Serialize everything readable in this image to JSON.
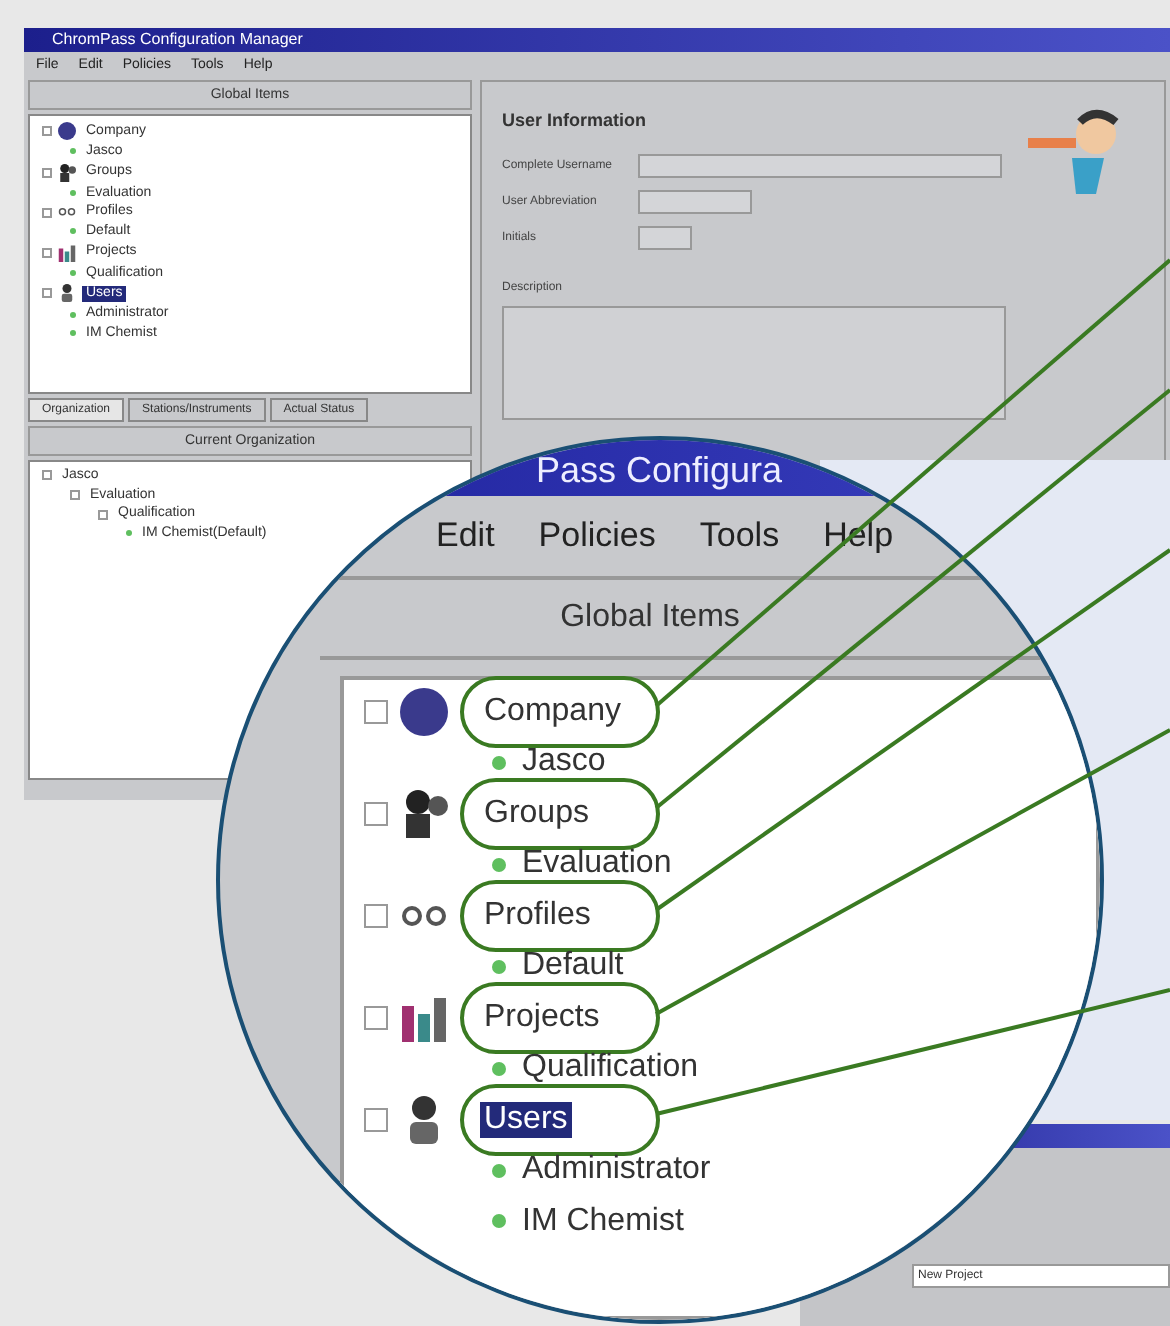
{
  "window": {
    "title": "ChromPass Configuration Manager",
    "menu": [
      "File",
      "Edit",
      "Policies",
      "Tools",
      "Help"
    ]
  },
  "global_items": {
    "title": "Global Items",
    "tree": [
      {
        "label": "Company",
        "kind": "company",
        "selected": false,
        "children": [
          {
            "label": "Jasco"
          }
        ]
      },
      {
        "label": "Groups",
        "kind": "groups",
        "selected": false,
        "children": [
          {
            "label": "Evaluation"
          }
        ]
      },
      {
        "label": "Profiles",
        "kind": "profiles",
        "selected": false,
        "children": [
          {
            "label": "Default"
          }
        ]
      },
      {
        "label": "Projects",
        "kind": "projects",
        "selected": false,
        "children": [
          {
            "label": "Qualification"
          }
        ]
      },
      {
        "label": "Users",
        "kind": "users",
        "selected": true,
        "children": [
          {
            "label": "Administrator"
          },
          {
            "label": "IM Chemist"
          }
        ]
      }
    ],
    "tabs": [
      {
        "label": "Organization",
        "selected": true
      },
      {
        "label": "Stations/Instruments",
        "selected": false
      },
      {
        "label": "Actual Status",
        "selected": false
      }
    ]
  },
  "current_organization": {
    "title": "Current Organization",
    "tree": [
      {
        "label": "Jasco",
        "children": [
          {
            "label": "Evaluation",
            "children": [
              {
                "label": "Qualification",
                "children": [
                  {
                    "label": "IM Chemist(Default)"
                  }
                ]
              }
            ]
          }
        ]
      }
    ]
  },
  "user_information": {
    "title": "User Information",
    "fields": [
      {
        "label": "Complete Username"
      },
      {
        "label": "User Abbreviation"
      },
      {
        "label": "Initials"
      }
    ],
    "description_label": "Description"
  },
  "second_window": {
    "field_value": "New Project"
  },
  "magnifier": {
    "title": "Pass Configura",
    "menu": [
      "Edit",
      "Policies",
      "Tools",
      "Help"
    ],
    "header": "Global Items",
    "tree": [
      {
        "label": "Company",
        "kind": "company",
        "selected": false,
        "children": [
          {
            "label": "Jasco"
          }
        ]
      },
      {
        "label": "Groups",
        "kind": "groups",
        "selected": false,
        "children": [
          {
            "label": "Evaluation"
          }
        ]
      },
      {
        "label": "Profiles",
        "kind": "profiles",
        "selected": false,
        "children": [
          {
            "label": "Default"
          }
        ]
      },
      {
        "label": "Projects",
        "kind": "projects",
        "selected": false,
        "children": [
          {
            "label": "Qualification"
          }
        ]
      },
      {
        "label": "Users",
        "kind": "users",
        "selected": true,
        "children": [
          {
            "label": "Administrator"
          },
          {
            "label": "IM Chemist"
          }
        ]
      }
    ]
  }
}
